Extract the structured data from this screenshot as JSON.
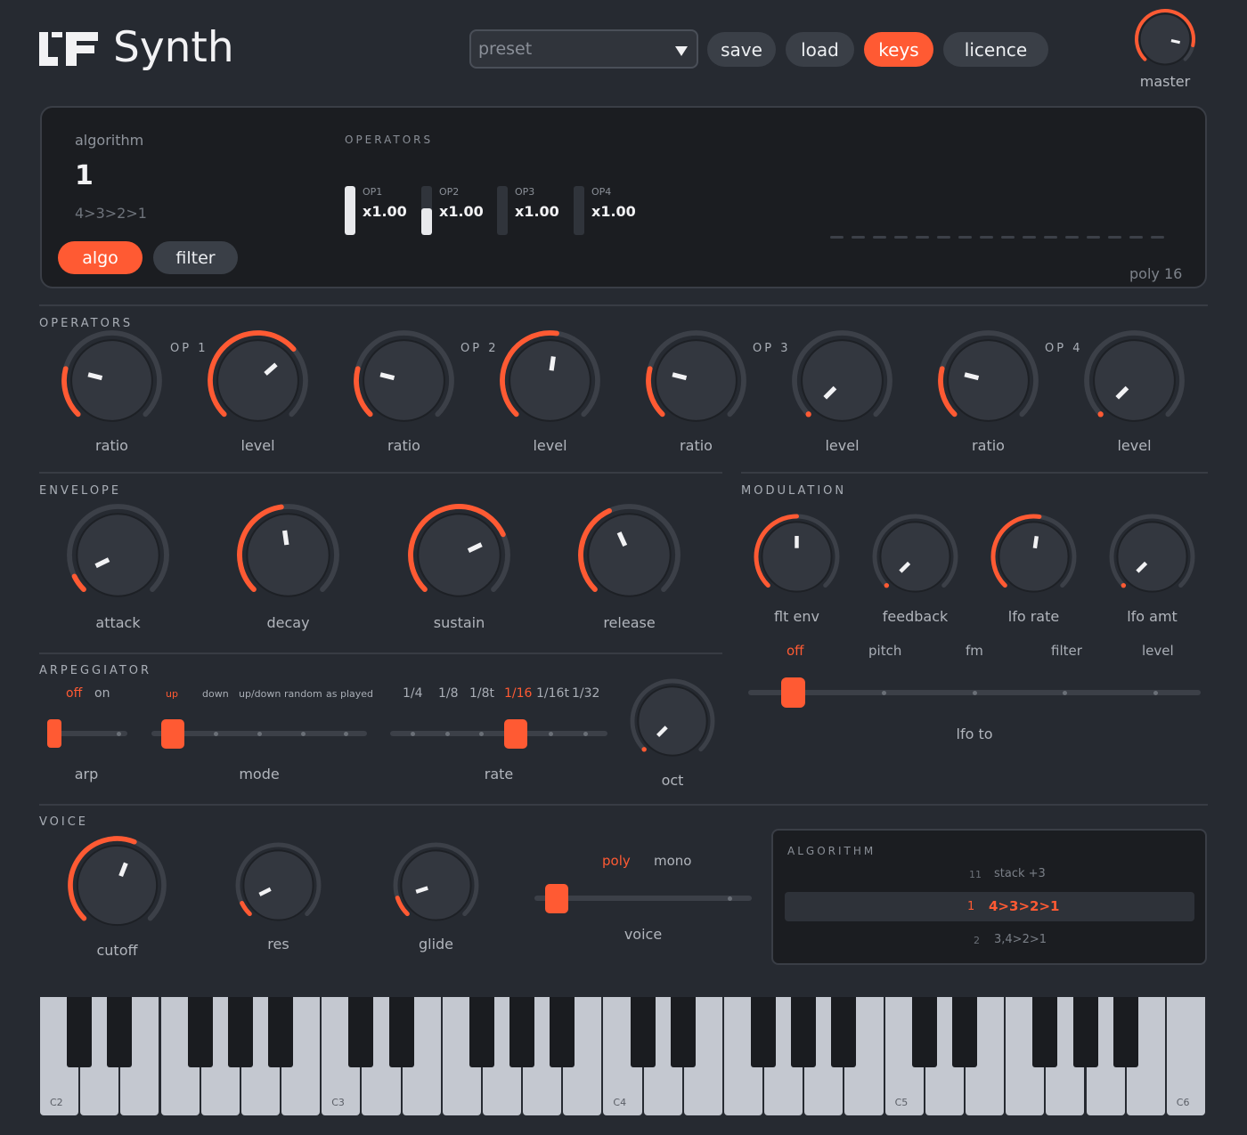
{
  "app": {
    "title": "Synth"
  },
  "header": {
    "preset_placeholder": "preset",
    "buttons": [
      {
        "label": "save",
        "active": false
      },
      {
        "label": "load",
        "active": false
      },
      {
        "label": "keys",
        "active": true
      },
      {
        "label": "licence",
        "active": false
      }
    ],
    "master_label": "master",
    "master_value": 0.88
  },
  "display": {
    "algorithm_label": "algorithm",
    "algorithm_number": "1",
    "algorithm_route": "4>3>2>1",
    "tabs": [
      {
        "label": "algo",
        "active": true
      },
      {
        "label": "filter",
        "active": false
      }
    ],
    "operators_heading": "OPERATORS",
    "operators": [
      {
        "name": "OP1",
        "value": "x1.00",
        "level": 1.0
      },
      {
        "name": "OP2",
        "value": "x1.00",
        "level": 0.55
      },
      {
        "name": "OP3",
        "value": "x1.00",
        "level": 0.0
      },
      {
        "name": "OP4",
        "value": "x1.00",
        "level": 0.0
      }
    ],
    "voice_slot_count": 16,
    "poly_label": "poly 16"
  },
  "operators_section": {
    "heading": "OPERATORS",
    "ops": [
      {
        "title": "OP 1",
        "knobs": [
          {
            "label": "ratio",
            "value": 0.22
          },
          {
            "label": "level",
            "value": 0.68
          }
        ]
      },
      {
        "title": "OP 2",
        "knobs": [
          {
            "label": "ratio",
            "value": 0.22
          },
          {
            "label": "level",
            "value": 0.53
          }
        ]
      },
      {
        "title": "OP 3",
        "knobs": [
          {
            "label": "ratio",
            "value": 0.22
          },
          {
            "label": "level",
            "value": 0.0
          }
        ]
      },
      {
        "title": "OP 4",
        "knobs": [
          {
            "label": "ratio",
            "value": 0.22
          },
          {
            "label": "level",
            "value": 0.0
          }
        ]
      }
    ]
  },
  "envelope": {
    "heading": "ENVELOPE",
    "knobs": [
      {
        "label": "attack",
        "value": 0.07
      },
      {
        "label": "decay",
        "value": 0.47
      },
      {
        "label": "sustain",
        "value": 0.74
      },
      {
        "label": "release",
        "value": 0.41
      }
    ]
  },
  "modulation": {
    "heading": "MODULATION",
    "knobs": [
      {
        "label": "flt env",
        "value": 0.5
      },
      {
        "label": "feedback",
        "value": 0.0
      },
      {
        "label": "lfo rate",
        "value": 0.53
      },
      {
        "label": "lfo amt",
        "value": 0.0
      }
    ],
    "lfo_to": {
      "options": [
        "off",
        "pitch",
        "fm",
        "filter",
        "level"
      ],
      "selected": "off",
      "label": "lfo to"
    }
  },
  "arpeggiator": {
    "heading": "ARPEGGIATOR",
    "arp": {
      "options": [
        "off",
        "on"
      ],
      "selected": "off",
      "label": "arp"
    },
    "mode": {
      "options": [
        "up",
        "down",
        "up/down",
        "random",
        "as played"
      ],
      "selected": "up",
      "label": "mode"
    },
    "rate": {
      "options": [
        "1/4",
        "1/8",
        "1/8t",
        "1/16",
        "1/16t",
        "1/32"
      ],
      "selected": "1/16",
      "label": "rate"
    },
    "oct": {
      "label": "oct",
      "value": 0.0
    }
  },
  "voice": {
    "heading": "VOICE",
    "knobs": [
      {
        "label": "cutoff",
        "value": 0.58
      },
      {
        "label": "res",
        "value": 0.07
      },
      {
        "label": "glide",
        "value": 0.1
      }
    ],
    "mode": {
      "options": [
        "poly",
        "mono"
      ],
      "selected": "poly",
      "label": "voice"
    }
  },
  "algorithm_list": {
    "heading": "ALGORITHM",
    "items": [
      {
        "num": "11",
        "route": "stack +3",
        "selected": false
      },
      {
        "num": "1",
        "route": "4>3>2>1",
        "selected": true
      },
      {
        "num": "2",
        "route": "3,4>2>1",
        "selected": false
      }
    ]
  },
  "keyboard": {
    "white_key_count": 29,
    "labels": [
      {
        "text": "C2",
        "key": 0
      },
      {
        "text": "C3",
        "key": 7
      },
      {
        "text": "C4",
        "key": 14
      },
      {
        "text": "C5",
        "key": 21
      },
      {
        "text": "C6",
        "key": 28
      }
    ]
  },
  "colors": {
    "accent": "#ff5a33",
    "bg": "#262a31",
    "display": "#1b1d21",
    "track": "#3c4048"
  }
}
